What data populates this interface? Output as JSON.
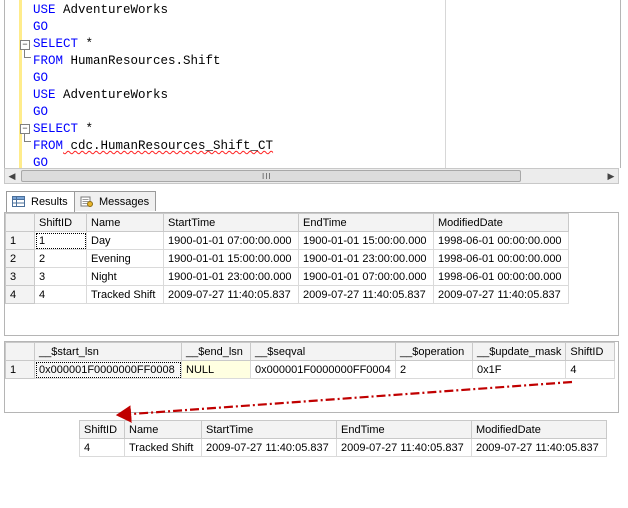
{
  "editor": {
    "lines": [
      {
        "kw": "USE",
        "rest": " AdventureWorks"
      },
      {
        "kw": "GO",
        "rest": ""
      },
      {
        "kw": "SELECT",
        "rest": " *"
      },
      {
        "kw": "FROM",
        "rest": " HumanResources.Shift"
      },
      {
        "kw": "GO",
        "rest": ""
      },
      {
        "kw": "USE",
        "rest": " AdventureWorks"
      },
      {
        "kw": "GO",
        "rest": ""
      },
      {
        "kw": "SELECT",
        "rest": " *"
      },
      {
        "kw": "FROM",
        "rest": " cdc.HumanResources_Shift_CT"
      },
      {
        "kw": "GO",
        "rest": ""
      }
    ],
    "fold_collapse_symbol": "−",
    "scroll_grip": "III"
  },
  "tabs": {
    "results": "Results",
    "messages": "Messages"
  },
  "grid1": {
    "columns": [
      "ShiftID",
      "Name",
      "StartTime",
      "EndTime",
      "ModifiedDate"
    ],
    "rows": [
      {
        "rn": "1",
        "cells": [
          "1",
          "Day",
          "1900-01-01 07:00:00.000",
          "1900-01-01 15:00:00.000",
          "1998-06-01 00:00:00.000"
        ]
      },
      {
        "rn": "2",
        "cells": [
          "2",
          "Evening",
          "1900-01-01 15:00:00.000",
          "1900-01-01 23:00:00.000",
          "1998-06-01 00:00:00.000"
        ]
      },
      {
        "rn": "3",
        "cells": [
          "3",
          "Night",
          "1900-01-01 23:00:00.000",
          "1900-01-01 07:00:00.000",
          "1998-06-01 00:00:00.000"
        ]
      },
      {
        "rn": "4",
        "cells": [
          "4",
          "Tracked Shift",
          "2009-07-27 11:40:05.837",
          "2009-07-27 11:40:05.837",
          "2009-07-27 11:40:05.837"
        ]
      }
    ]
  },
  "grid2": {
    "columns": [
      "__$start_lsn",
      "__$end_lsn",
      "__$seqval",
      "__$operation",
      "__$update_mask",
      "ShiftID"
    ],
    "rows": [
      {
        "rn": "1",
        "cells": [
          "0x000001F0000000FF0008",
          "NULL",
          "0x000001F0000000FF0004",
          "2",
          "0x1F",
          "4"
        ]
      }
    ]
  },
  "grid3": {
    "columns": [
      "ShiftID",
      "Name",
      "StartTime",
      "EndTime",
      "ModifiedDate"
    ],
    "rows": [
      {
        "cells": [
          "4",
          "Tracked Shift",
          "2009-07-27 11:40:05.837",
          "2009-07-27 11:40:05.837",
          "2009-07-27 11:40:05.837"
        ]
      }
    ]
  },
  "colors": {
    "keyword": "#0000ff",
    "annotation_arrow": "#c00000",
    "null_cell": "#ffffe1",
    "margin_bar": "#ffec8b"
  }
}
